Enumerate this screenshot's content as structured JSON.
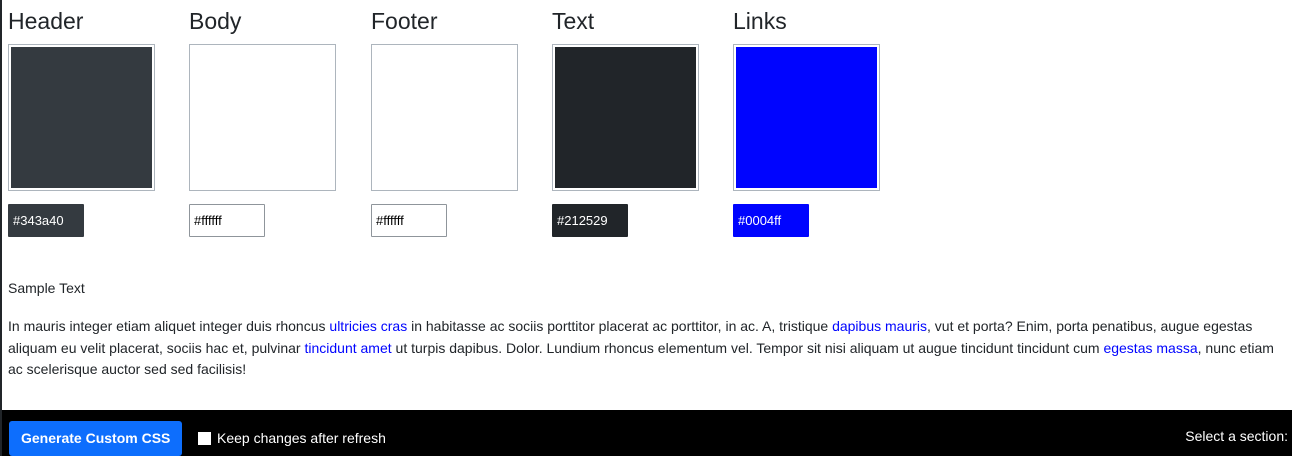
{
  "swatches": [
    {
      "title": "Header",
      "value": "#343a40",
      "color": "#343a40",
      "input_bg": "#343a40",
      "input_fg": "#ffffff"
    },
    {
      "title": "Body",
      "value": "#ffffff",
      "color": "#ffffff",
      "input_bg": "#ffffff",
      "input_fg": "#000000"
    },
    {
      "title": "Footer",
      "value": "#ffffff",
      "color": "#ffffff",
      "input_bg": "#ffffff",
      "input_fg": "#000000"
    },
    {
      "title": "Text",
      "value": "#212529",
      "color": "#212529",
      "input_bg": "#212529",
      "input_fg": "#ffffff"
    },
    {
      "title": "Links",
      "value": "#0004ff",
      "color": "#0004ff",
      "input_bg": "#0004ff",
      "input_fg": "#ffffff"
    }
  ],
  "sample": {
    "heading": "Sample Text",
    "seg1": "In mauris integer etiam aliquet integer duis rhoncus ",
    "link1": "ultricies cras",
    "seg2": " in habitasse ac sociis porttitor placerat ac porttitor, in ac. A, tristique ",
    "link2": "dapibus mauris",
    "seg3": ", vut et porta? Enim, porta penatibus, augue egestas aliquam eu velit placerat, sociis hac et, pulvinar ",
    "link3": "tincidunt amet",
    "seg4": " ut turpis dapibus. Dolor. Lundium rhoncus elementum vel. Tempor sit nisi aliquam ut augue tincidunt tincidunt cum ",
    "link4": "egestas massa",
    "seg5": ", nunc etiam ac scelerisque auctor sed sed facilisis!"
  },
  "footer": {
    "generate_label": "Generate Custom CSS",
    "keep_label": "Keep changes after refresh",
    "keep_checked": false,
    "select_label": "Select a section:"
  }
}
